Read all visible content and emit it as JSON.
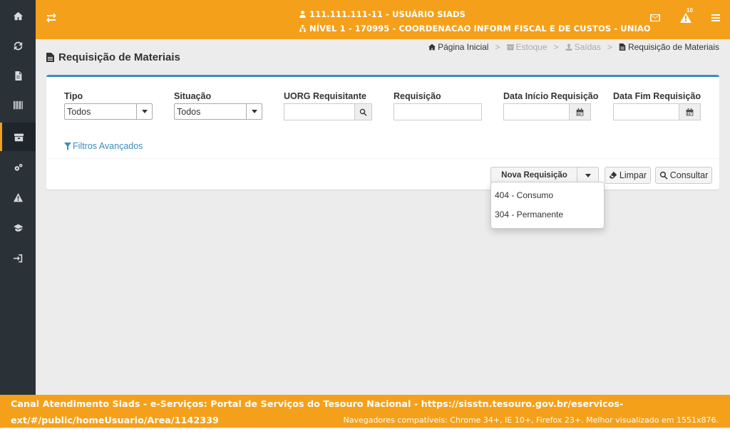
{
  "header": {
    "user": "111.111.111-11 - USUÁRIO SIADS",
    "unit": "NÍVEL 1 - 170995 - COORDENACAO INFORM FISCAL E DE CUSTOS - UNIAO",
    "alerts_count": "10"
  },
  "sidebar": {
    "items": [
      {
        "icon": "home-icon"
      },
      {
        "icon": "refresh-icon"
      },
      {
        "icon": "file-icon"
      },
      {
        "icon": "barcode-icon"
      },
      {
        "icon": "archive-icon",
        "active": true
      },
      {
        "icon": "cogs-icon"
      },
      {
        "icon": "warning-icon"
      },
      {
        "icon": "graduation-cap-icon"
      },
      {
        "icon": "sign-in-icon"
      }
    ]
  },
  "page": {
    "title": "Requisição de Materiais"
  },
  "breadcrumb": {
    "home": "Página Inicial",
    "estoque": "Estoque",
    "saidas": "Saídas",
    "current": "Requisição de Materiais",
    "separator": ">"
  },
  "filters": {
    "tipo_label": "Tipo",
    "tipo_value": "Todos",
    "situacao_label": "Situação",
    "situacao_value": "Todos",
    "uorg_label": "UORG Requisitante",
    "uorg_value": "",
    "requisicao_label": "Requisição",
    "requisicao_value": "",
    "data_inicio_label": "Data Início Requisição",
    "data_inicio_value": "",
    "data_fim_label": "Data Fim Requisição",
    "data_fim_value": "",
    "advanced": "Filtros Avançados"
  },
  "actions": {
    "nova": "Nova Requisição",
    "limpar": "Limpar",
    "consultar": "Consultar"
  },
  "dropdown": {
    "items": [
      "404 - Consumo",
      "304 - Permanente"
    ]
  },
  "footer": {
    "text": "Canal Atendimento Siads - e-Serviços: Portal de Serviços do Tesouro Nacional - https://sisstn.tesouro.gov.br/eservicos-ext/#/public/homeUsuario/Area/1142339",
    "compat": "Navegadores compatíveis: Chrome 34+, IE 10+, Firefox 23+. Melhor visualizado em 1551x876."
  },
  "colors": {
    "accent": "#f5a01a",
    "sidebar": "#2a3238",
    "panel_top": "#3c8dbc",
    "link": "#3c8dbc"
  }
}
